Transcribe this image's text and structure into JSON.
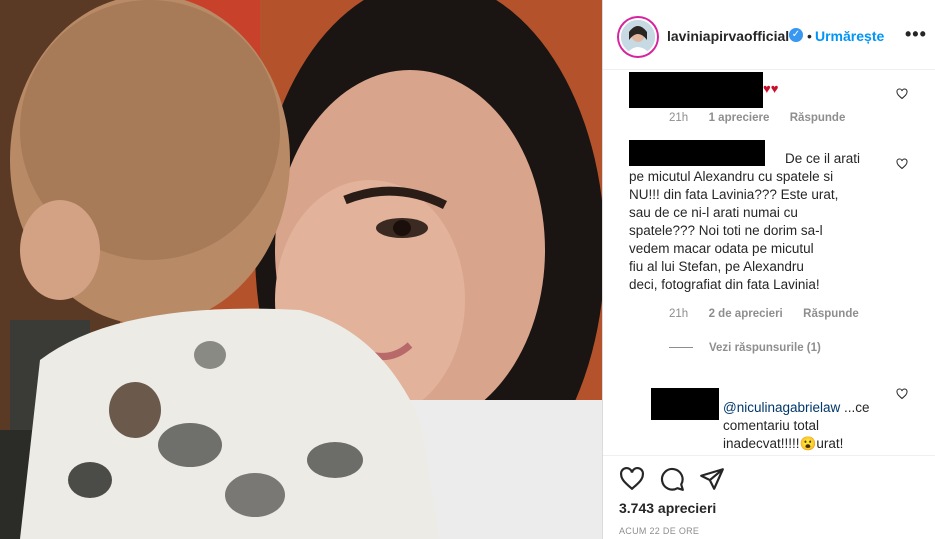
{
  "post": {
    "username": "laviniapirvaofficial",
    "verified_mark": "✓",
    "follow_label": "Urmărește",
    "more_label": "•••",
    "likes": "3.743 aprecieri",
    "time": "ACUM 22 DE ORE"
  },
  "comments": [
    {
      "text": "",
      "emoji": "♥♥",
      "age": "21h",
      "likes": "1 apreciere",
      "reply": "Răspunde"
    },
    {
      "text": "De ce il arati pe micutul Alexandru cu spatele si NU!!! din fata Lavinia??? Este urat, sau de ce ni-l arati numai cu spatele??? Noi toti ne dorim sa-l vedem macar odata pe micutul fiu al lui Stefan, pe Alexandru deci, fotografiat din fata Lavinia!",
      "age": "21h",
      "likes": "2 de aprecieri",
      "reply": "Răspunde",
      "view_replies": "Vezi răspunsurile (1)"
    },
    {
      "mention": "@niculinagabrielaw",
      "text": " ...ce comentariu total inadecvat!!!!!😮urat!"
    }
  ],
  "comment2_lines": [
    "De ce il arati",
    "pe micutul Alexandru cu spatele si",
    "NU!!! din fata Lavinia??? Este urat,",
    "sau de ce ni-l arati numai cu",
    "spatele??? Noi toti ne dorim sa-l",
    "vedem macar odata pe micutul",
    "fiu al lui Stefan, pe Alexandru",
    "deci, fotografiat din fata Lavinia!"
  ],
  "comment3_lines": [
    "comentariu total",
    "inadecvat!!!!!😮urat!"
  ],
  "comment3_first_rest": " ...ce",
  "icons": [
    "heart-icon",
    "comment-icon",
    "share-icon",
    "comment-heart-icon",
    "verified-badge-icon",
    "more-options-icon"
  ],
  "colors": {
    "link": "#0095f6",
    "verified": "#3897f0",
    "heart": "#c8102e",
    "mention": "#00376b"
  }
}
